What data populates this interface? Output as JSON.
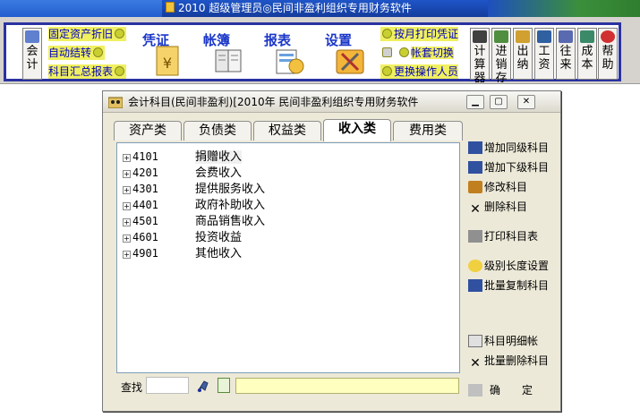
{
  "taskbar": {
    "title": "2010 超级管理员◎民间非盈利组织专用财务软件"
  },
  "toolbar": {
    "left_tool": "会计",
    "links": [
      "固定资产折旧",
      "自动结转",
      "科目汇总报表"
    ],
    "big_buttons": [
      "凭证",
      "帐簿",
      "报表",
      "设置"
    ],
    "right_links": [
      "按月打印凭证",
      "帐套切换",
      "更换操作人员"
    ],
    "vertical_tools": [
      "计算器",
      "进销存",
      "出纳",
      "工资",
      "往来",
      "成本",
      "帮助"
    ]
  },
  "window": {
    "title": "会计科目(民间非盈利)[2010年 民间非盈利组织专用财务软件",
    "tabs": [
      "资产类",
      "负债类",
      "权益类",
      "收入类",
      "费用类"
    ],
    "active_tab": "收入类",
    "accounts": [
      {
        "code": "4101",
        "name": "捐赠收入"
      },
      {
        "code": "4201",
        "name": "会费收入"
      },
      {
        "code": "4301",
        "name": "提供服务收入"
      },
      {
        "code": "4401",
        "name": "政府补助收入"
      },
      {
        "code": "4501",
        "name": "商品销售收入"
      },
      {
        "code": "4601",
        "name": "投资收益"
      },
      {
        "code": "4901",
        "name": "其他收入"
      }
    ],
    "search_label": "查找",
    "search_value": "",
    "actions": [
      "增加同级科目",
      "增加下级科目",
      "修改科目",
      "删除科目",
      "打印科目表",
      "级别长度设置",
      "批量复制科目",
      "科目明细帐",
      "批量删除科目",
      "确　　定"
    ]
  }
}
